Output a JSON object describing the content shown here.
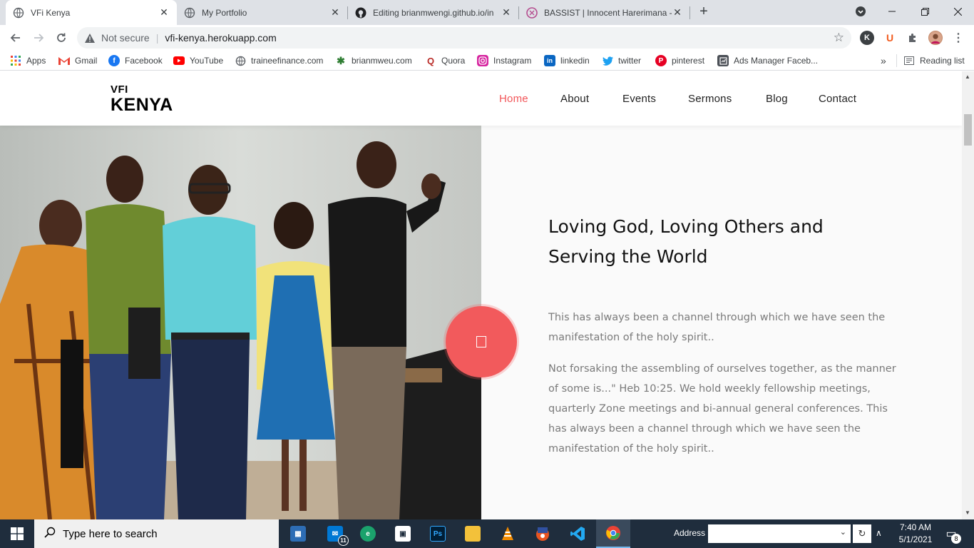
{
  "browser": {
    "tabs": [
      {
        "title": "VFi Kenya",
        "favicon": "globe-icon",
        "active": true
      },
      {
        "title": "My Portfolio",
        "favicon": "globe-icon",
        "active": false
      },
      {
        "title": "Editing brianmwengi.github.io/in",
        "favicon": "github-icon",
        "active": false
      },
      {
        "title": "BASSIST | Innocent Harerimana -",
        "favicon": "bassist-icon",
        "active": false
      }
    ],
    "new_tab": "+",
    "omnibox": {
      "security": "Not secure",
      "divider": "|",
      "url": "vfi-kenya.herokuapp.com"
    },
    "bookmarks": [
      {
        "label": "Apps",
        "icon": "apps-grid-icon"
      },
      {
        "label": "Gmail",
        "icon": "gmail-icon"
      },
      {
        "label": "Facebook",
        "icon": "facebook-icon"
      },
      {
        "label": "YouTube",
        "icon": "youtube-icon"
      },
      {
        "label": "traineefinance.com",
        "icon": "globe-icon"
      },
      {
        "label": "brianmweu.com",
        "icon": "brian-icon"
      },
      {
        "label": "Quora",
        "icon": "quora-icon"
      },
      {
        "label": "Instagram",
        "icon": "instagram-icon"
      },
      {
        "label": "linkedin",
        "icon": "linkedin-icon"
      },
      {
        "label": "twitter",
        "icon": "twitter-icon"
      },
      {
        "label": "pinterest",
        "icon": "pinterest-icon"
      },
      {
        "label": "Ads Manager Faceb...",
        "icon": "ads-manager-icon"
      }
    ],
    "bookmarks_more": "»",
    "reading_list": "Reading list"
  },
  "site": {
    "logo_top": "VFI",
    "logo_bottom": "KENYA",
    "nav": [
      {
        "label": "Home",
        "active": true
      },
      {
        "label": "About",
        "active": false
      },
      {
        "label": "Events",
        "active": false
      },
      {
        "label": "Sermons",
        "active": false
      },
      {
        "label": "Blog",
        "active": false
      },
      {
        "label": "Contact",
        "active": false
      }
    ],
    "headline": "Loving God, Loving Others and Serving the World",
    "paragraphs": [
      "This has always been a channel through which we have seen the manifestation of the holy spirit..",
      "Not forsaking the assembling of ourselves together, as the manner of some is...\" Heb 10:25. We hold weekly fellowship meetings, quarterly Zone meetings and bi-annual general conferences. This has always been a channel through which we have seen the manifestation of the holy spirit.."
    ],
    "accent_color": "#f2575a"
  },
  "taskbar": {
    "search_placeholder": "Type here to search",
    "mail_badge": "11",
    "address_label": "Address",
    "time": "7:40 AM",
    "date": "5/1/2021",
    "notification_count": "8"
  }
}
